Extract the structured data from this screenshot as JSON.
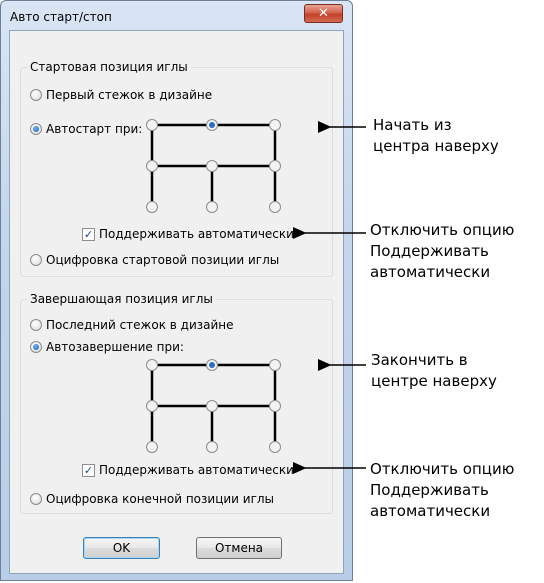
{
  "window": {
    "title": "Авто старт/стоп",
    "close_glyph": "✕"
  },
  "start_group": {
    "title": "Стартовая позиция иглы",
    "option_first": "Первый стежок в дизайне",
    "option_auto": "Автостарт при:",
    "maintain_label": "Поддерживать автоматически",
    "maintain_checked": true,
    "option_digitize": "Оцифровка стартовой позиции иглы",
    "selected_option": "option_auto",
    "selected_position": "top-center"
  },
  "end_group": {
    "title": "Завершающая позиция иглы",
    "option_last": "Последний стежок в дизайне",
    "option_auto": "Автозавершение при:",
    "maintain_label": "Поддерживать автоматически",
    "maintain_checked": true,
    "option_digitize": "Оцифровка конечной позиции иглы",
    "selected_option": "option_auto",
    "selected_position": "top-center"
  },
  "buttons": {
    "ok": "OK",
    "cancel": "Отмена"
  },
  "annotations": {
    "start_pos": [
      "Начать из",
      "центра наверху"
    ],
    "start_maintain": [
      "Отключить опцию",
      "Поддерживать",
      "автоматически"
    ],
    "end_pos": [
      "Закончить в",
      "центре наверху"
    ],
    "end_maintain": [
      "Отключить опцию",
      "Поддерживать",
      "автоматически"
    ]
  },
  "icons": {
    "checkmark": "check-icon",
    "radio": "radio-icon",
    "arrow": "arrow-left-icon"
  }
}
